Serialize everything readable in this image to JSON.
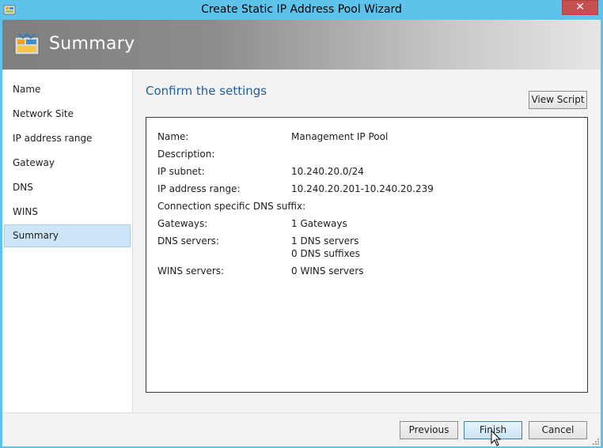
{
  "window": {
    "title": "Create Static IP Address Pool Wizard",
    "close_glyph": "✕",
    "app_icon": "wizard-app-icon"
  },
  "banner": {
    "title": "Summary",
    "icon": "summary-wizard-icon"
  },
  "sidebar": {
    "items": [
      {
        "label": "Name"
      },
      {
        "label": "Network Site"
      },
      {
        "label": "IP address range"
      },
      {
        "label": "Gateway"
      },
      {
        "label": "DNS"
      },
      {
        "label": "WINS"
      },
      {
        "label": "Summary",
        "selected": true
      }
    ]
  },
  "main": {
    "section_title": "Confirm the settings",
    "view_script_label": "View Script",
    "summary": [
      {
        "label": "Name:",
        "value": "Management IP Pool"
      },
      {
        "label": "Description:",
        "value": ""
      },
      {
        "label": "IP subnet:",
        "value": "10.240.20.0/24"
      },
      {
        "label": "IP address range:",
        "value": "10.240.20.201-10.240.20.239"
      },
      {
        "label": "Connection specific DNS suffix:",
        "value": ""
      },
      {
        "label": "Gateways:",
        "value": "1 Gateways"
      },
      {
        "label": "DNS servers:",
        "value": "1 DNS servers",
        "value2": "0 DNS suffixes"
      },
      {
        "label": "WINS servers:",
        "value": "0 WINS servers"
      }
    ]
  },
  "footer": {
    "previous_label": "Previous",
    "finish_label": "Finish",
    "cancel_label": "Cancel"
  },
  "colors": {
    "window_frame": "#5ec3ea",
    "close_button": "#c74f50",
    "section_title": "#1f5f9a",
    "selected_nav": "#cde6f7"
  }
}
